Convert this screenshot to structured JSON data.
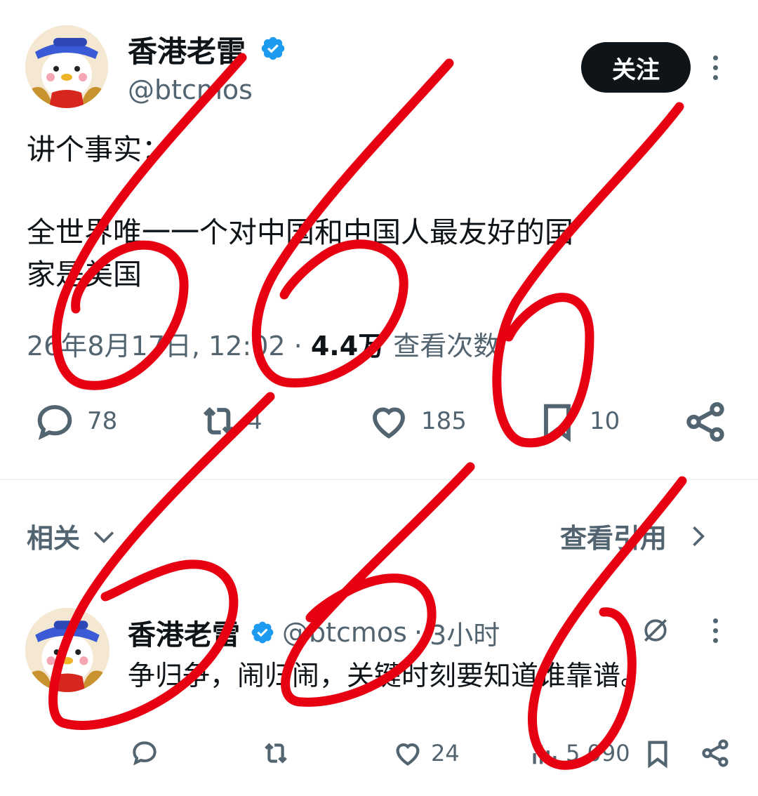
{
  "tweet": {
    "author_name": "香港老雷",
    "author_handle": "@btcmos",
    "follow_label": "关注",
    "text_line1": "讲个事实：",
    "text_line2": "全世界唯一一个对中国和中国人最友好的国",
    "text_line3": "家是美国",
    "date": "26年8月17日, 12:02",
    "separator": "·",
    "views_count": "4.4万",
    "views_label": "查看次数",
    "reply_count": "78",
    "retweet_count": "4",
    "like_count": "185",
    "bookmark_count": "10"
  },
  "related": {
    "label": "相关",
    "view_quotes_label": "查看引用"
  },
  "reply_tweet": {
    "author_name": "香港老雷",
    "author_handle": "@btcmos",
    "separator": "·",
    "time": "3小时",
    "text": "争归争，闹归闹，关键时刻要知道谁靠谱。",
    "like_count": "24",
    "views_count": "5,090"
  },
  "colors": {
    "text_primary": "#0f1419",
    "text_secondary": "#536471",
    "verified_blue": "#1d9bf0",
    "scribble_red": "#e60012"
  }
}
